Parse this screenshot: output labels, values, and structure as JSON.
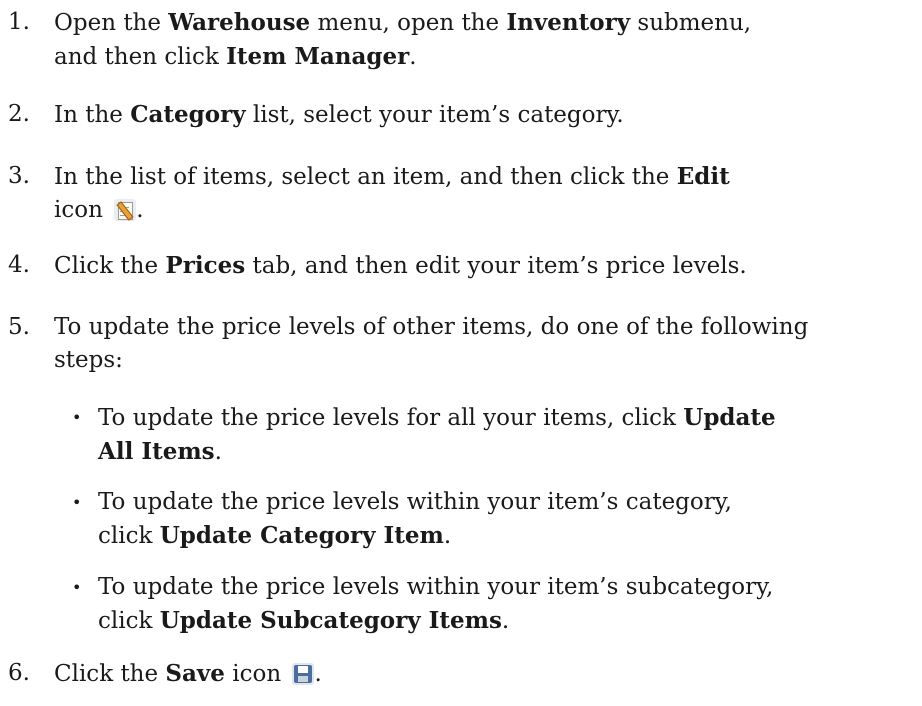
{
  "steps": [
    {
      "num": "1.",
      "l1_a": "Open the ",
      "l1_b": "Warehouse",
      "l1_c": " menu, open the ",
      "l1_d": "Inventory",
      "l1_e": " submenu,",
      "l2_a": "and then click ",
      "l2_b": "Item Manager",
      "l2_c": "."
    },
    {
      "num": "2.",
      "a": "In the ",
      "b": "Category",
      "c": " list, select your item’s category."
    },
    {
      "num": "3.",
      "a": "In the list of items, select an item, and then click the ",
      "b": "Edit",
      "c": "icon ",
      "d": ".",
      "icon": "edit-icon"
    },
    {
      "num": "4.",
      "a": "Click the ",
      "b": "Prices",
      "c": " tab, and then edit your item’s price levels."
    },
    {
      "num": "5.",
      "l1": "To update the price levels of other items, do one of the following",
      "l2": "steps:"
    },
    {
      "num": "6.",
      "a": "Click the ",
      "b": "Save",
      "c": " icon ",
      "d": ".",
      "icon": "save-icon"
    }
  ],
  "substeps": [
    {
      "bullet": "•",
      "l1_a": "To update the price levels for all your items, click ",
      "l1_b": "Update",
      "l2_b": "All Items",
      "l2_c": "."
    },
    {
      "bullet": "•",
      "l1": "To update the price levels within your item’s category,",
      "l2_a": "click ",
      "l2_b": "Update Category Item",
      "l2_c": "."
    },
    {
      "bullet": "•",
      "l1": "To update the price levels within your item’s subcategory,",
      "l2_a": "click ",
      "l2_b": "Update Subcategory Items",
      "l2_c": "."
    }
  ]
}
